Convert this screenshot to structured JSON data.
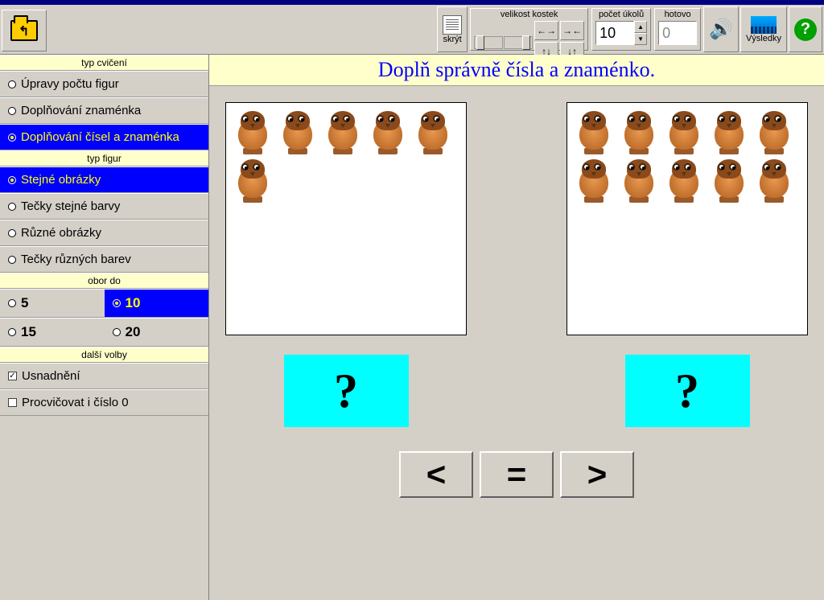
{
  "toolbar": {
    "hide_label": "skrýt",
    "size_label": "velikost kostek",
    "tasks_label": "počet úkolů",
    "tasks_value": "10",
    "done_label": "hotovo",
    "done_value": "0",
    "results_label": "Výsledky"
  },
  "sidebar": {
    "exercise_type_header": "typ cvičení",
    "exercise_types": [
      "Úpravy počtu figur",
      "Doplňování znaménka",
      "Doplňování čísel a znaménka"
    ],
    "figure_type_header": "typ figur",
    "figure_types": [
      "Stejné obrázky",
      "Tečky stejné barvy",
      "Různé obrázky",
      "Tečky různých barev"
    ],
    "range_header": "obor do",
    "ranges": [
      "5",
      "10",
      "15",
      "20"
    ],
    "more_header": "další volby",
    "ease_label": "Usnadnění",
    "zero_label": "Procvičovat i číslo 0"
  },
  "content": {
    "instruction": "Doplň správně čísla a znaménko.",
    "left_count": 6,
    "right_count": 10,
    "left_answer": "?",
    "right_answer": "?",
    "operators": [
      "<",
      "=",
      ">"
    ]
  }
}
